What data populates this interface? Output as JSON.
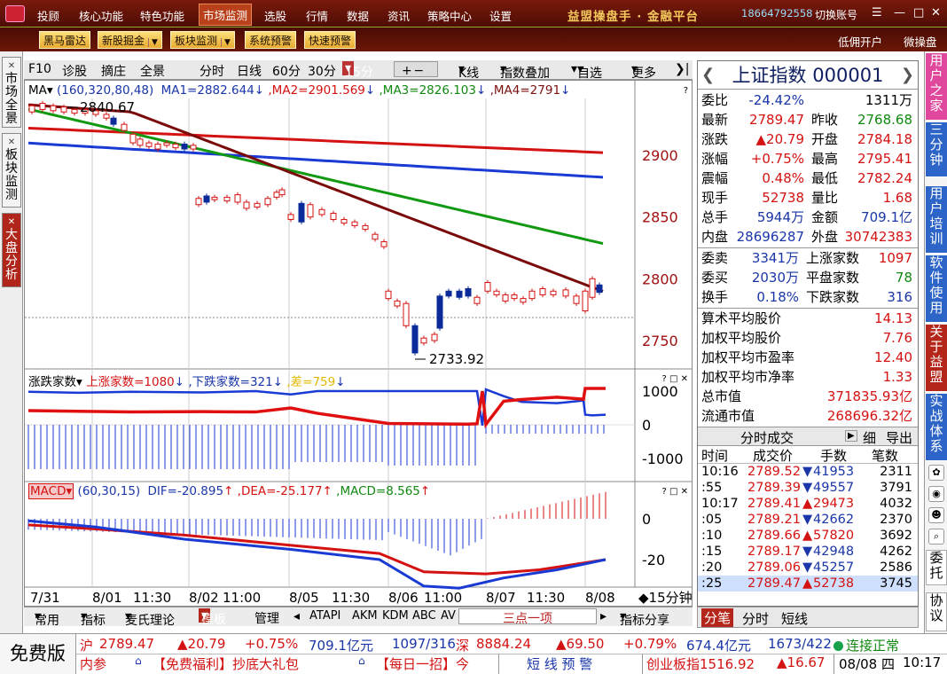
{
  "menu": {
    "items": [
      "投顾",
      "核心功能",
      "特色功能",
      "市场监测",
      "选股",
      "行情",
      "数据",
      "资讯",
      "策略中心",
      "设置"
    ],
    "active": "市场监测",
    "brand": "益盟操盘手 · 金融平台",
    "phone": "18664792558",
    "switch_account": "切换账号"
  },
  "toolbar": {
    "buttons": [
      "黑马雷达",
      "新股掘金",
      "板块监测",
      "系统预警",
      "快速预警"
    ],
    "right": [
      "低佣开户",
      "微操盘"
    ]
  },
  "left_tabs": [
    "市场全景",
    "板块监测",
    "大盘分析"
  ],
  "chart_toolbar": {
    "items": [
      "F10",
      "诊股",
      "摘庄",
      "全景",
      "分时",
      "日线",
      "60分",
      "30分",
      "15分",
      "+",
      "−",
      "K线",
      "指数叠加",
      "自选",
      "更多",
      "❯|"
    ],
    "active_period": "15分"
  },
  "ma_header": {
    "name": "MA",
    "params": "(160,320,80,48)",
    "ma1": "MA1=2882.644",
    "ma2": ",MA2=2901.569",
    "ma3": ",MA3=2826.103",
    "ma4": ",MA4=2791"
  },
  "adv_header": {
    "name": "涨跌家数",
    "up": "上涨家数=1080",
    "down": ",下跌家数=321",
    "diff": ",差=759"
  },
  "macd_header": {
    "name": "MACD",
    "params": "(60,30,15)",
    "dif": "DIF=-20.895",
    "dea": ",DEA=-25.177",
    "macd": ",MACD=8.565"
  },
  "main_axis": [
    "2900",
    "2850",
    "2800",
    "2750"
  ],
  "adv_axis": [
    "1000",
    "0",
    "-1000"
  ],
  "macd_axis": [
    "0",
    "-20"
  ],
  "annotations": {
    "high": "2840.67",
    "low": "2733.92"
  },
  "time_axis": [
    "7/31",
    "8/01",
    "11:30",
    "8/02",
    "11:00",
    "8/05",
    "11:30",
    "8/06",
    "11:00",
    "8/07",
    "11:30",
    "8/08",
    "◆15分钟"
  ],
  "bottom_tabs": [
    "常用",
    "指标",
    "麦氏理论",
    "模板",
    "管理",
    "ATAPI",
    "AKM",
    "KDM",
    "ABC",
    "AV",
    "三点一项",
    "指标分享"
  ],
  "quote": {
    "title": "上证指数",
    "code": "000001",
    "rows": [
      {
        "l1": "委比",
        "v1": "-24.42%",
        "c1": "blu",
        "l2": "",
        "v2": "1311万",
        "c2": "blk"
      },
      {
        "l1": "最新",
        "v1": "2789.47",
        "c1": "red",
        "l2": "昨收",
        "v2": "2768.68",
        "c2": "grn"
      },
      {
        "l1": "涨跌",
        "v1": "▲20.79",
        "c1": "red",
        "l2": "开盘",
        "v2": "2784.18",
        "c2": "red"
      },
      {
        "l1": "涨幅",
        "v1": "+0.75%",
        "c1": "red",
        "l2": "最高",
        "v2": "2795.41",
        "c2": "red"
      },
      {
        "l1": "震幅",
        "v1": "0.48%",
        "c1": "red",
        "l2": "最低",
        "v2": "2782.24",
        "c2": "red"
      },
      {
        "l1": "现手",
        "v1": "52738",
        "c1": "red",
        "l2": "量比",
        "v2": "1.68",
        "c2": "red"
      },
      {
        "l1": "总手",
        "v1": "5944万",
        "c1": "blu",
        "l2": "金额",
        "v2": "709.1亿",
        "c2": "blu"
      },
      {
        "l1": "内盘",
        "v1": "28696287",
        "c1": "blu",
        "l2": "外盘",
        "v2": "30742383",
        "c2": "red"
      }
    ],
    "rows2": [
      {
        "l1": "委卖",
        "v1": "3341万",
        "c1": "blu",
        "l2": "上涨家数",
        "v2": "1097",
        "c2": "red"
      },
      {
        "l1": "委买",
        "v1": "2030万",
        "c1": "blu",
        "l2": "平盘家数",
        "v2": "78",
        "c2": "grn"
      },
      {
        "l1": "换手",
        "v1": "0.18%",
        "c1": "blu",
        "l2": "下跌家数",
        "v2": "316",
        "c2": "blu"
      }
    ],
    "stats": [
      {
        "label": "算术平均股价",
        "value": "14.13"
      },
      {
        "label": "加权平均股价",
        "value": "7.76"
      },
      {
        "label": "加权平均市盈率",
        "value": "12.40"
      },
      {
        "label": "加权平均市净率",
        "value": "1.33"
      },
      {
        "label": "总市值",
        "value": "371835.93亿"
      },
      {
        "label": "流通市值",
        "value": "268696.32亿"
      }
    ],
    "ts_bar": {
      "title": "分时成交",
      "detail": "细",
      "export": "导出"
    },
    "ts_headers": [
      "时间",
      "成交价",
      "手数",
      "笔数"
    ],
    "ticks": [
      {
        "t": "10:16",
        "p": "2789.52",
        "d": "▼",
        "v": "41953",
        "n": "2311"
      },
      {
        "t": ":55",
        "p": "2789.39",
        "d": "▼",
        "v": "49557",
        "n": "3791"
      },
      {
        "t": "10:17",
        "p": "2789.41",
        "d": "▲",
        "v": "29473",
        "n": "4032"
      },
      {
        "t": ":05",
        "p": "2789.21",
        "d": "▼",
        "v": "42662",
        "n": "2370"
      },
      {
        "t": ":10",
        "p": "2789.66",
        "d": "▲",
        "v": "57820",
        "n": "3692"
      },
      {
        "t": ":15",
        "p": "2789.17",
        "d": "▼",
        "v": "42948",
        "n": "4262"
      },
      {
        "t": ":20",
        "p": "2789.06",
        "d": "▼",
        "v": "45257",
        "n": "2586"
      },
      {
        "t": ":25",
        "p": "2789.47",
        "d": "▲",
        "v": "52738",
        "n": "3745"
      }
    ],
    "tabs": [
      "分笔",
      "分时",
      "短线"
    ]
  },
  "right_bar": [
    "用户之家",
    "三分钟",
    "用户培训",
    "软件使用",
    "关于益盟",
    "实战体系",
    "委托",
    "协议"
  ],
  "status": {
    "free": "免费版",
    "sh_label": "沪",
    "sh_price": "2789.47",
    "sh_chg": "▲20.79",
    "sh_pct": "+0.75%",
    "sh_amt": "709.1亿元",
    "sh_adv": "1097/316",
    "sz_label": "深",
    "sz_price": "8884.24",
    "sz_chg": "▲69.50",
    "sz_pct": "+0.79%",
    "sz_amt": "674.4亿元",
    "sz_adv": "1673/422",
    "conn": "连接正常",
    "news1": "内参",
    "news2": "【免费福利】抄底大礼包",
    "news3": "【每日一招】今",
    "alert": "短 线 预 警",
    "cyb": "创业板指1516.92",
    "cyb_chg": "▲16.67",
    "date": "08/08 四",
    "time": "10:17"
  }
}
